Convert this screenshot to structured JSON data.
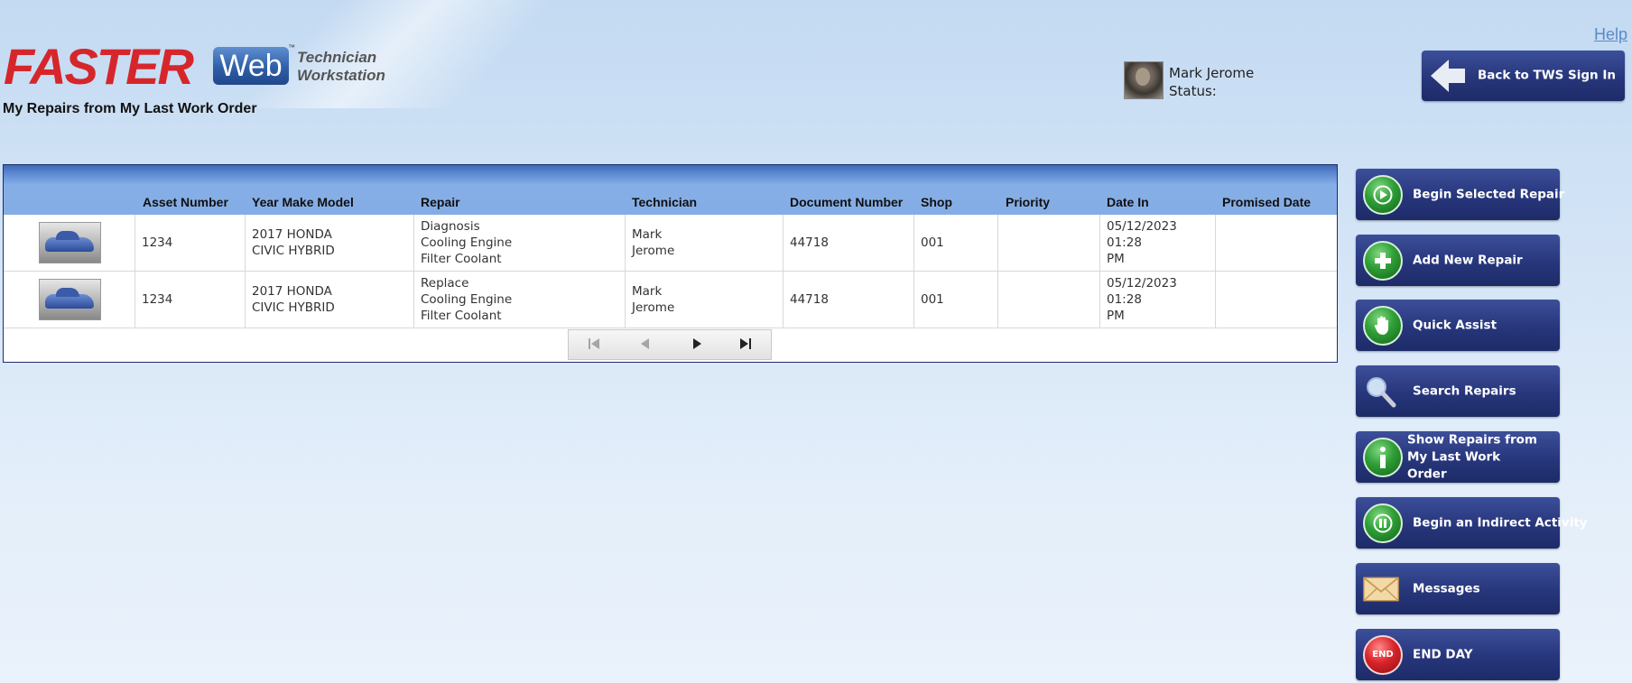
{
  "logo": {
    "brand": "FASTER",
    "web": "Web",
    "tm": "™",
    "product_line1": "Technician",
    "product_line2": "Workstation"
  },
  "page_title": "My Repairs from My Last Work Order",
  "help_link": "Help",
  "user": {
    "name": "Mark Jerome",
    "status_label": "Status:"
  },
  "back_button": {
    "label": "Back to TWS Sign In",
    "icon": "left-arrow-icon"
  },
  "grid": {
    "columns": [
      "Asset Number",
      "Year Make Model",
      "Repair",
      "Technician",
      "Document Number",
      "Shop",
      "Priority",
      "Date In",
      "Promised Date"
    ],
    "rows": [
      {
        "asset_number": "1234",
        "year_make_model": [
          "2017 HONDA",
          "CIVIC HYBRID"
        ],
        "repair": [
          "Diagnosis",
          "Cooling Engine",
          "Filter Coolant"
        ],
        "technician": [
          "Mark",
          "Jerome"
        ],
        "document_number": "44718",
        "shop": "001",
        "priority": "",
        "date_in": [
          "05/12/2023 01:28",
          "PM"
        ],
        "promised_date": ""
      },
      {
        "asset_number": "1234",
        "year_make_model": [
          "2017 HONDA",
          "CIVIC HYBRID"
        ],
        "repair": [
          "Replace",
          "Cooling Engine",
          "Filter Coolant"
        ],
        "technician": [
          "Mark",
          "Jerome"
        ],
        "document_number": "44718",
        "shop": "001",
        "priority": "",
        "date_in": [
          "05/12/2023 01:28",
          "PM"
        ],
        "promised_date": ""
      }
    ]
  },
  "side_buttons": [
    {
      "label": "Begin Selected Repair",
      "icon": "play-icon"
    },
    {
      "label": "Add New Repair",
      "icon": "plus-icon"
    },
    {
      "label": "Quick Assist",
      "icon": "hand-icon"
    },
    {
      "label": "Search Repairs",
      "icon": "magnifier-icon"
    },
    {
      "label_lines": [
        "Show Repairs from",
        "My Last Work",
        "Order"
      ],
      "icon": "info-icon"
    },
    {
      "label": "Begin an Indirect Activity",
      "icon": "pause-icon"
    },
    {
      "label": "Messages",
      "icon": "envelope-icon"
    },
    {
      "label": "END DAY",
      "icon": "end-icon",
      "icon_text": "END"
    }
  ]
}
